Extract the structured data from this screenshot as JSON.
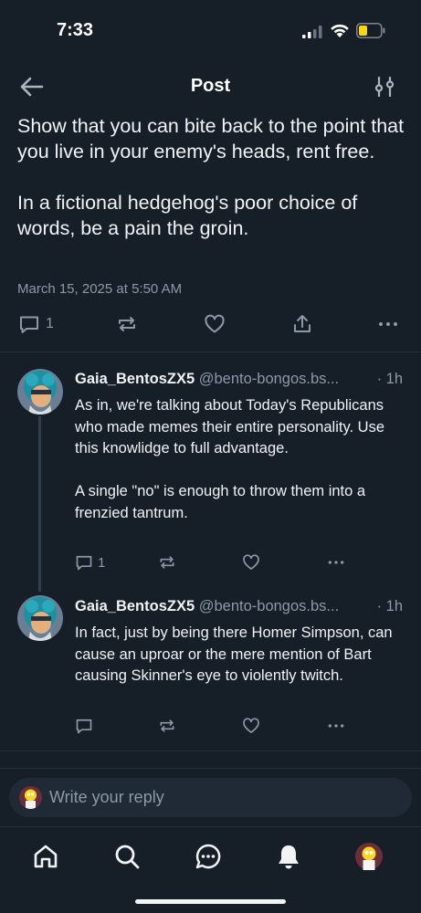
{
  "status_bar": {
    "time": "7:33"
  },
  "header": {
    "title": "Post"
  },
  "post": {
    "text": "Show that you can bite back to the point that you live in your enemy's heads, rent free.\n\nIn a fictional hedgehog's poor choice of words, be a pain the groin.",
    "date": "March 15, 2025 at 5:50 AM",
    "reply_count": "1"
  },
  "replies": [
    {
      "name": "Gaia_BentosZX5",
      "handle": "@bento-bongos.bs...",
      "time": "· 1h",
      "text": "As in, we're talking about Today's Republicans who made memes their entire personality. Use this knowlidge to full advantage.\n\nA single \"no\" is enough to throw them into a frenzied tantrum.",
      "reply_count": "1"
    },
    {
      "name": "Gaia_BentosZX5",
      "handle": "@bento-bongos.bs...",
      "time": "· 1h",
      "text": "In fact, just by being there Homer Simpson, can cause an uproar or the mere mention of Bart causing Skinner's eye to violently twitch.",
      "reply_count": ""
    }
  ],
  "composer": {
    "placeholder": "Write your reply"
  },
  "tabs": [
    "home-icon",
    "search-icon",
    "chat-icon",
    "notifications-icon",
    "profile-avatar"
  ],
  "colors": {
    "background": "#161e27",
    "muted": "#8c99a8",
    "text": "#f1f3f5",
    "battery": "#ffd60a"
  }
}
